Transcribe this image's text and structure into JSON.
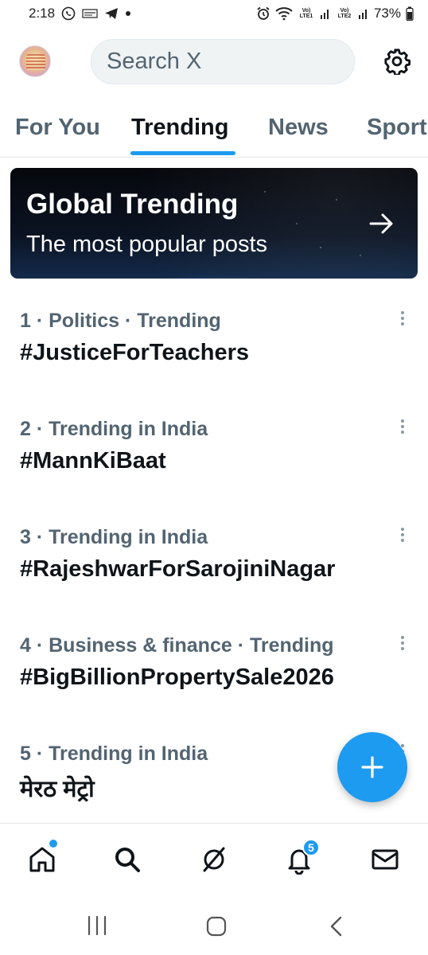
{
  "status_bar": {
    "time": "2:18",
    "battery": "73%",
    "sim1_label": "Vo) LTE1",
    "sim2_label": "Vo) LTE2"
  },
  "header": {
    "search_placeholder": "Search X"
  },
  "tabs": [
    {
      "label": "For You"
    },
    {
      "label": "Trending"
    },
    {
      "label": "News"
    },
    {
      "label": "Sport"
    }
  ],
  "active_tab": "Trending",
  "banner": {
    "title": "Global Trending",
    "subtitle": "The most popular posts"
  },
  "trends": [
    {
      "meta": "1 · Politics · Trending",
      "name": "#JusticeForTeachers"
    },
    {
      "meta": "2 · Trending in India",
      "name": "#MannKiBaat"
    },
    {
      "meta": "3 · Trending in India",
      "name": "#RajeshwarForSarojiniNagar"
    },
    {
      "meta": "4 · Business & finance · Trending",
      "name": "#BigBillionPropertySale2026"
    },
    {
      "meta": "5 · Trending in India",
      "name": "मेरठ मेट्रो"
    }
  ],
  "bottom_nav": {
    "notifications_badge": "5",
    "items": [
      "home-icon",
      "search-icon",
      "grok-icon",
      "bell-icon",
      "mail-icon"
    ]
  },
  "colors": {
    "accent": "#1d9bf0",
    "text_primary": "#0f1419",
    "text_secondary": "#536471"
  }
}
